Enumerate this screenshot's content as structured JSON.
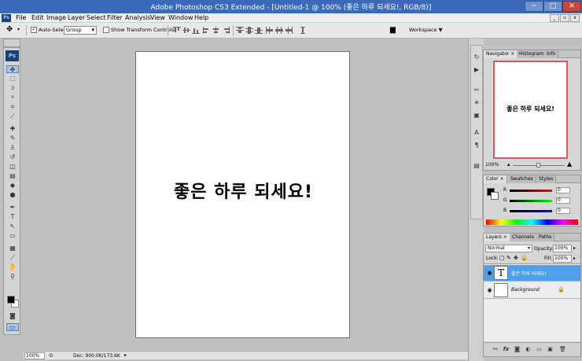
{
  "window": {
    "title": "Adobe Photoshop CS3 Extended - [Untitled-1 @ 100% (좋은 하루 되세요!, RGB/8)]",
    "controls": {
      "minimize": "─",
      "maximize": "□",
      "close": "✕"
    },
    "mdi_controls": {
      "minimize": "_",
      "restore": "▫",
      "close": "x"
    }
  },
  "app_badge": "Ps",
  "menu": [
    "File",
    "Edit",
    "Image",
    "Layer",
    "Select",
    "Filter",
    "Analysis",
    "View",
    "Window",
    "Help"
  ],
  "options": {
    "auto_select_label": "Auto-Select:",
    "auto_select_value": "Group",
    "show_transform_label": "Show Transform Controls",
    "workspace_label": "Workspace ▼"
  },
  "tool_icons": [
    "move-icon",
    "marquee-icon",
    "lasso-icon",
    "magic-wand-icon",
    "crop-icon",
    "slice-icon",
    "healing-icon",
    "brush-icon",
    "stamp-icon",
    "history-brush-icon",
    "eraser-icon",
    "gradient-icon",
    "blur-icon",
    "dodge-icon",
    "pen-icon",
    "type-icon",
    "path-select-icon",
    "shape-icon",
    "notes-icon",
    "eyedropper-icon",
    "hand-icon",
    "zoom-icon"
  ],
  "tool_glyphs": [
    "✥",
    "⬚",
    "ↄ",
    "✧",
    "⌗",
    "⟋",
    "✚",
    "✎",
    "♙",
    "↺",
    "◫",
    "▤",
    "◆",
    "●",
    "✒",
    "T",
    "↖",
    "▭",
    "▦",
    "⟋",
    "✋",
    "⚲"
  ],
  "colors": {
    "foreground": "#000000",
    "background": "#ffffff",
    "selection": "#4fa0e9",
    "navigator_box": "#d35b5b"
  },
  "document": {
    "text": "좋은 하루 되세요!"
  },
  "status": {
    "zoom": "100%",
    "doc_info": "Doc: 900.0K/173.6K"
  },
  "navigator": {
    "tabs": [
      "Navigator ×",
      "Histogram",
      "Info"
    ],
    "preview_text": "좋은 하루 되세요!",
    "zoom": "100%"
  },
  "color_panel": {
    "tabs": [
      "Color ×",
      "Swatches",
      "Styles"
    ],
    "channels": [
      {
        "label": "R",
        "value": "0"
      },
      {
        "label": "G",
        "value": "0"
      },
      {
        "label": "B",
        "value": "0"
      }
    ]
  },
  "layers_panel": {
    "tabs": [
      "Layers ×",
      "Channels",
      "Paths"
    ],
    "blend_mode": "Normal",
    "opacity_label": "Opacity:",
    "opacity_value": "100%",
    "lock_label": "Lock:",
    "fill_label": "Fill:",
    "fill_value": "100%",
    "layers": [
      {
        "name": "좋은 하루 되세요!",
        "thumb": "T",
        "selected": true
      },
      {
        "name": "Background",
        "thumb": "",
        "selected": false,
        "locked": true
      }
    ],
    "footer_icons": [
      "link-icon",
      "fx-icon",
      "mask-icon",
      "adjustment-icon",
      "group-icon",
      "new-layer-icon",
      "trash-icon"
    ],
    "footer_glyphs": [
      "⚯",
      "fx",
      "◙",
      "◐",
      "▭",
      "▣",
      "🗑"
    ]
  }
}
